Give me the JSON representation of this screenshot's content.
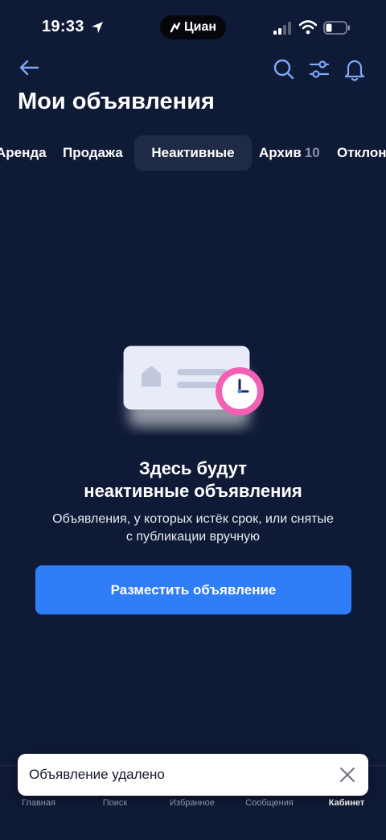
{
  "status_bar": {
    "time": "19:33",
    "island_label": "Циан"
  },
  "header": {
    "title": "Мои объявления",
    "icons": [
      "arrow-left-icon",
      "search-icon",
      "filter-sliders-icon",
      "bell-icon"
    ]
  },
  "tabs": [
    {
      "label": "Аренда"
    },
    {
      "label": "Продажа"
    },
    {
      "label": "Неактивные",
      "selected": true
    },
    {
      "label": "Архив",
      "count": "10"
    },
    {
      "label": "Отклон"
    }
  ],
  "empty_state": {
    "title_line1": "Здесь будут",
    "title_line2": "неактивные объявления",
    "description_line1": "Объявления, у которых истёк срок, или снятые",
    "description_line2": "с публикации вручную",
    "button_label": "Разместить объявление"
  },
  "bottom_nav": {
    "items": [
      "Главная",
      "Поиск",
      "Избранное",
      "Сообщения",
      "Кабинет"
    ],
    "active": "Кабинет"
  },
  "toast": {
    "text": "Объявление удалено"
  },
  "colors": {
    "background": "#0f1a36",
    "accent": "#2f7ef8",
    "selected_tab": "#1f2b45",
    "clock_ring": "#f35fb2"
  }
}
